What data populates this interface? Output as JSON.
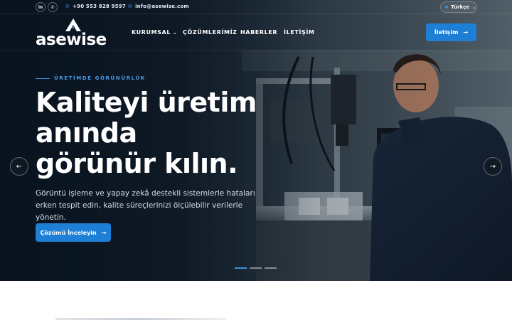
{
  "topbar": {
    "social": [
      {
        "name": "linkedin-icon",
        "glyph": "in"
      },
      {
        "name": "whatsapp-icon",
        "glyph": "✆"
      }
    ],
    "phone": "+90 553 828 9597",
    "email": "info@asewise.com",
    "language": "Türkçe"
  },
  "nav": {
    "logo_text": "asewise",
    "items": [
      {
        "label": "KURUMSAL",
        "has_dropdown": true
      },
      {
        "label": "ÇÖZÜMLERİMİZ",
        "has_dropdown": false
      },
      {
        "label": "HABERLER",
        "has_dropdown": false
      },
      {
        "label": "İLETİŞİM",
        "has_dropdown": false
      }
    ],
    "cta_label": "İletişim"
  },
  "hero": {
    "eyebrow": "ÜRETİMDE GÖRÜNÜRLÜK",
    "headline": "Kaliteyi üretim anında görünür kılın.",
    "subtext": "Görüntü işleme ve yapay zekâ destekli sistemlerle hataları erken tespit edin, kalite süreçlerinizi ölçülebilir verilerle yönetin.",
    "cta_label": "Çözümü İnceleyin",
    "prev_glyph": "←",
    "next_glyph": "→",
    "slides_total": 3,
    "slide_active": 1
  },
  "colors": {
    "accent": "#1e7fd6",
    "accent_light": "#3d8fe0",
    "hero_dark": "#0c1a28"
  }
}
